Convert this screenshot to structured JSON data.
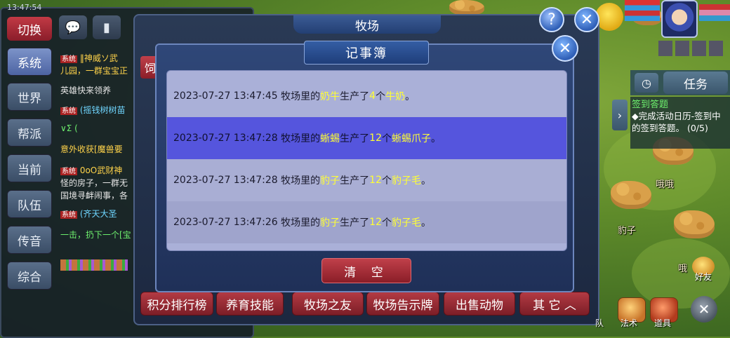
{
  "chat_panel": {
    "clock": "13:47:54",
    "switch_label": "切换",
    "channels": [
      "系统",
      "世界",
      "帮派",
      "当前",
      "队伍",
      "传音",
      "综合"
    ],
    "lines": [
      {
        "tag": "系统",
        "text": "‖神威ソ武"
      },
      {
        "tag": "",
        "text": "儿园，一群宝宝正"
      },
      {
        "tag": "",
        "text": "英雄快来领养"
      },
      {
        "tag": "系统",
        "text": "(摇钱树树苗"
      },
      {
        "tag": "",
        "text": "∨Σ ("
      },
      {
        "tag": "",
        "text": "意外收获[魔兽要"
      },
      {
        "tag": "系统",
        "text": "0oO武财神"
      },
      {
        "tag": "",
        "text": "怪的房子，一群无"
      },
      {
        "tag": "",
        "text": "国境寻衅闹事，各"
      },
      {
        "tag": "系统",
        "text": "(齐天大圣"
      },
      {
        "tag": "",
        "text": "一击，扔下一个[宝"
      }
    ]
  },
  "pasture": {
    "title": "牧场",
    "tabs": [
      "积分排行榜",
      "养育技能",
      "牧场之友",
      "牧场告示牌",
      "出售动物",
      "其 它"
    ],
    "tab_side_label": "饲"
  },
  "notebook": {
    "title": "记事簿",
    "clear_label": "清 空",
    "entries": [
      {
        "time": "2023-07-27 13:47:45",
        "prefix": "牧场里的",
        "animal": "奶牛",
        "verb": "生产了",
        "qty": "4",
        "unit": "个",
        "product": "牛奶",
        "end": "。"
      },
      {
        "time": "2023-07-27 13:47:28",
        "prefix": "牧场里的",
        "animal": "蜥蜴",
        "verb": "生产了",
        "qty": "12",
        "unit": "个",
        "product": "蜥蜴爪子",
        "end": "。"
      },
      {
        "time": "2023-07-27 13:47:28",
        "prefix": "牧场里的",
        "animal": "豹子",
        "verb": "生产了",
        "qty": "12",
        "unit": "个",
        "product": "豹子毛",
        "end": "。"
      },
      {
        "time": "2023-07-27 13:47:26",
        "prefix": "牧场里的",
        "animal": "豹子",
        "verb": "生产了",
        "qty": "12",
        "unit": "个",
        "product": "豹子毛",
        "end": "。"
      }
    ]
  },
  "task_panel": {
    "tab_label": "任务",
    "title": "签到答题",
    "text": "◆完成活动日历-签到中的签到答题。 (0/5)"
  },
  "world": {
    "labels": [
      "哦哦",
      "豹子",
      "哦",
      "好友"
    ]
  },
  "bottom_bar": [
    "队",
    "法术",
    "道具"
  ],
  "colors": {
    "highlight": "#ffff33",
    "selected_row": "#5555dd",
    "list_bg": "#aab0d8",
    "red_button": "#a52e39"
  }
}
